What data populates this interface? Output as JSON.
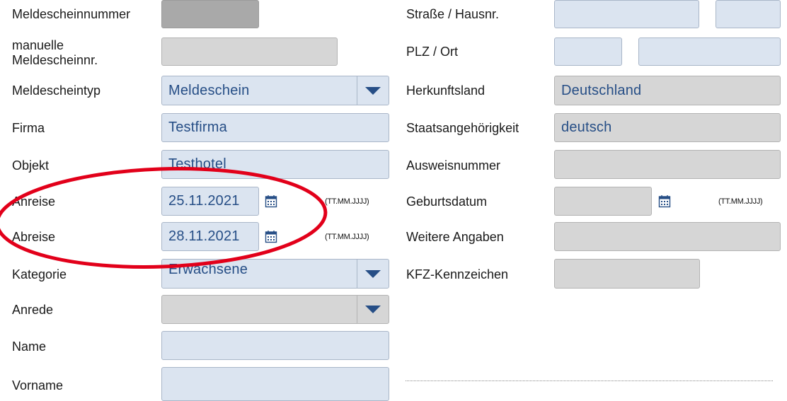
{
  "left": {
    "meldescheinnummer": {
      "label": "Meldescheinnummer"
    },
    "manuelle_nr": {
      "label": "manuelle Meldescheinnr."
    },
    "meldescheintyp": {
      "label": "Meldescheintyp",
      "value": "Meldeschein"
    },
    "firma": {
      "label": "Firma",
      "value": "Testfirma"
    },
    "objekt": {
      "label": "Objekt",
      "value": "Testhotel"
    },
    "anreise": {
      "label": "Anreise",
      "value": "25.11.2021",
      "format": "(TT.MM.JJJJ)"
    },
    "abreise": {
      "label": "Abreise",
      "value": "28.11.2021",
      "format": "(TT.MM.JJJJ)"
    },
    "kategorie": {
      "label": "Kategorie",
      "value": "Erwachsene"
    },
    "anrede": {
      "label": "Anrede",
      "value": ""
    },
    "name": {
      "label": "Name",
      "value": ""
    },
    "vorname": {
      "label": "Vorname",
      "value": ""
    }
  },
  "right": {
    "strasse": {
      "label": "Straße / Hausnr.",
      "value": "",
      "hausnr": ""
    },
    "plz_ort": {
      "label": "PLZ / Ort",
      "plz": "",
      "ort": ""
    },
    "herkunftsland": {
      "label": "Herkunftsland",
      "value": "Deutschland"
    },
    "staatsangehoerigkeit": {
      "label": "Staatsangehörigkeit",
      "value": "deutsch"
    },
    "ausweisnummer": {
      "label": "Ausweisnummer",
      "value": ""
    },
    "geburtsdatum": {
      "label": "Geburtsdatum",
      "value": "",
      "format": "(TT.MM.JJJJ)"
    },
    "weitere_angaben": {
      "label": "Weitere Angaben",
      "value": ""
    },
    "kfz_kennzeichen": {
      "label": "KFZ-Kennzeichen",
      "value": ""
    }
  },
  "icons": {
    "calendar": "calendar-icon",
    "dropdown": "chevron-down-icon"
  },
  "colors": {
    "field_blue": "#dbe4f0",
    "field_grey": "#d6d6d6",
    "value_text": "#264e86",
    "highlight": "#e2001a"
  }
}
